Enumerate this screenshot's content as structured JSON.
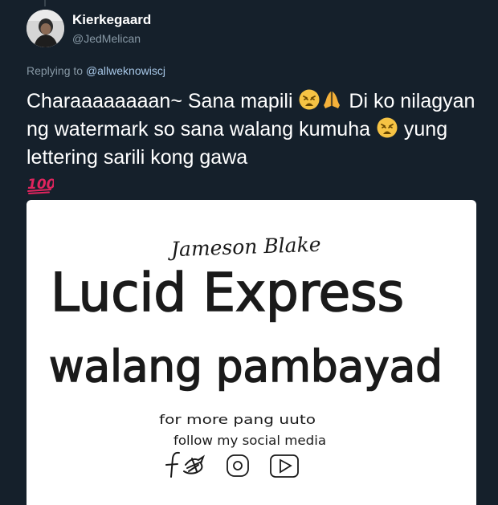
{
  "author": {
    "display_name": "Kierkegaard",
    "handle": "@JedMelican"
  },
  "reply": {
    "prefix": "Replying to",
    "mention": "@allweknowiscj"
  },
  "tweet": {
    "text_1": "Charaaaaaaaan~ Sana mapili ",
    "emoji_1": "weary-face",
    "emoji_2": "folded-hands",
    "text_2": " Di ko nilagyan ng watermark so sana walang kumuha ",
    "emoji_3": "weary-face",
    "text_3": " yung lettering sarili kong gawa",
    "emoji_4": "hundred-points"
  },
  "media": {
    "signature": "Jameson Blake",
    "line_1": "Lucid Express",
    "line_2": "walang pambayad",
    "line_3": "for more pang uuto",
    "line_4": "follow my social media",
    "social_icons": [
      "facebook-icon",
      "twitter-icon",
      "instagram-icon",
      "youtube-icon"
    ]
  },
  "colors": {
    "background": "#15202b",
    "secondary_text": "#8899a6",
    "mention": "#a8c8e8",
    "card_bg": "#ffffff"
  }
}
